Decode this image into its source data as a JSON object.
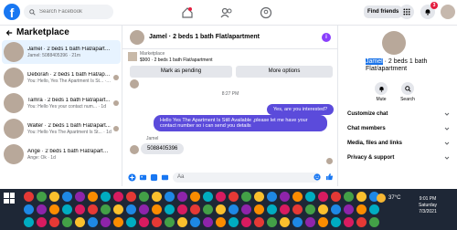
{
  "topbar": {
    "logo": "f",
    "search_placeholder": "Search Facebook",
    "find_friends": "Find friends",
    "notifications_count": "3",
    "brand_color": "#1877f2"
  },
  "left": {
    "title": "Marketplace",
    "conversations": [
      {
        "name": "Jamel · 2 beds 1 bath Flat/apartment",
        "sub": "Jamel: 5088405396 · 21m"
      },
      {
        "name": "Deborah · 2 beds 1 bath Flat/apar...",
        "sub": "You: Hello, Yes The Apartment Is St... · 1d"
      },
      {
        "name": "Tamra · 2 beds 1 bath Flat/apart...",
        "sub": "You: Hello Yes your contact num... · 1d"
      },
      {
        "name": "Walter · 2 beds 1 bath Flat/apart...",
        "sub": "You: Hello Yes The Apartment Is St... · 1d"
      },
      {
        "name": "Ange · 2 beds 1 bath Flat/apartment",
        "sub": "Ange: Ok · 1d"
      }
    ]
  },
  "chat": {
    "title": "Jamel · 2 beds 1 bath Flat/apartment",
    "listing_source": "Marketplace",
    "listing_text": "$900 · 2 beds 1 bath Flat/apartment",
    "mark_pending": "Mark as pending",
    "more_options": "More options",
    "timestamp": "8:27 PM",
    "messages": {
      "out1": "Yes, are you interested?",
      "out2": "Hello Yes The Apartment Is Still Available ,please let me have your contact number so i can send you details",
      "sender": "Jamel",
      "in1": "5088405396"
    },
    "composer_placeholder": "Aa",
    "accent_color": "#5b4bdb"
  },
  "right": {
    "name_highlight": "Jamel",
    "name_rest": " · 2 beds 1 bath Flat/apartment",
    "mute": "Mute",
    "search": "Search",
    "rows": [
      "Customize chat",
      "Chat members",
      "Media, files and links",
      "Privacy & support"
    ]
  },
  "taskbar": {
    "temperature": "37°C",
    "time": "9:01 PM",
    "day": "Saturday",
    "date": "7/3/2021"
  }
}
